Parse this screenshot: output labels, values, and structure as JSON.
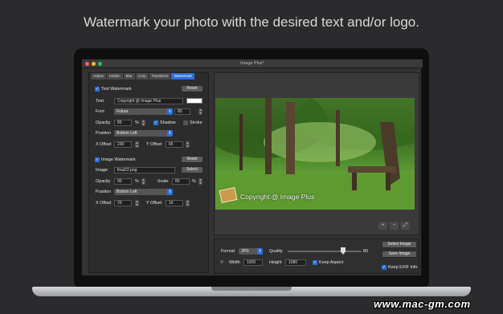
{
  "headline": "Watermark your photo with the desired text and/or logo.",
  "window": {
    "title": "Image Plus*"
  },
  "tabs": [
    "Adjust",
    "Artistic",
    "Blur",
    "Crop",
    "Transform",
    "Watermark"
  ],
  "selected_tab": "Watermark",
  "text_watermark": {
    "checkbox_label": "Text Watermark",
    "checked": true,
    "reset_label": "Reset",
    "text_label": "Text",
    "text_value": "Copyright @ Image Plus",
    "color": "#ffffff",
    "font_label": "Font",
    "font_value": "Futura",
    "font_size": "80",
    "opacity_label": "Opacity",
    "opacity_value": "85",
    "percent": "%",
    "shadow_label": "Shadow",
    "shadow_checked": true,
    "stroke_label": "Stroke",
    "stroke_checked": false,
    "position_label": "Position",
    "position_value": "Bottom Left",
    "x_offset_label": "X Offset",
    "x_offset_value": "230",
    "y_offset_label": "Y Offset",
    "y_offset_value": "65"
  },
  "image_watermark": {
    "checkbox_label": "Image Watermark",
    "checked": true,
    "reset_label": "Reset",
    "image_label": "Image",
    "image_value": "final22.png",
    "select_label": "Select",
    "opacity_label": "Opacity",
    "opacity_value": "90",
    "percent": "%",
    "scale_label": "Scale",
    "scale_value": "80",
    "scale_percent": "%",
    "position_label": "Position",
    "position_value": "Bottom Left",
    "x_offset_label": "X Offset",
    "x_offset_value": "20",
    "y_offset_label": "Y Offset",
    "y_offset_value": "16"
  },
  "preview": {
    "watermark_text": "Copyright @ Image Plus",
    "zoom_in": "+",
    "zoom_out": "−",
    "fit": "⤢"
  },
  "export": {
    "format_label": "Format",
    "format_value": "JPG",
    "quality_label": "Quality",
    "quality_value": "80",
    "width_label": "Width",
    "width_value": "1920",
    "height_label": "Height",
    "height_value": "1080",
    "keep_aspect_label": "Keep Aspect",
    "keep_aspect_checked": true,
    "select_image_label": "Select Image",
    "save_image_label": "Save Image",
    "keep_exif_label": "Keep EXIF Info",
    "keep_exif_checked": true
  },
  "site_watermark": "www.mac-gm.com"
}
